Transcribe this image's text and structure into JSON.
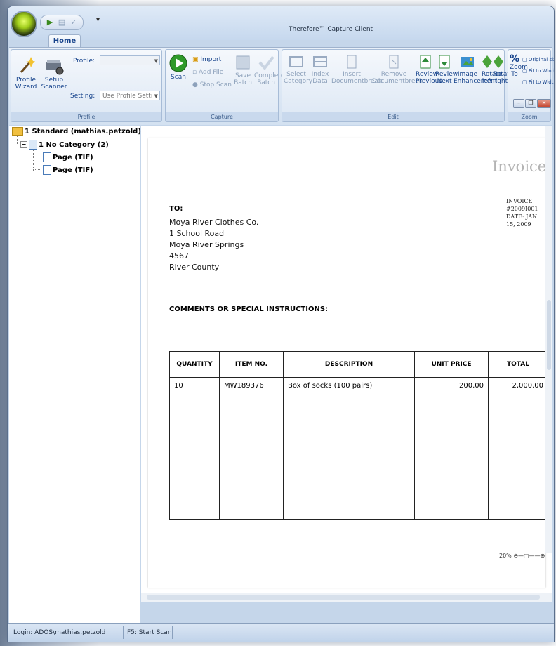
{
  "window": {
    "title": "Therefore™ Capture Client"
  },
  "ribbon": {
    "tab_home": "Home",
    "profile_group": {
      "label": "Profile",
      "profile_wizard": "Profile Wizard",
      "setup_scanner": "Setup Scanner",
      "profile_label": "Profile:",
      "profile_value": "",
      "setting_label": "Setting:",
      "setting_value": "Use Profile Setti"
    },
    "capture_group": {
      "label": "Capture",
      "scan": "Scan",
      "import": "Import",
      "add_file": "Add File",
      "stop_scan": "Stop Scan",
      "save_batch": "Save Batch",
      "complete_batch": "Complete Batch"
    },
    "edit_group": {
      "label": "Edit",
      "select_category": "Select Category",
      "index_data": "Index Data",
      "insert_documentbreak": "Insert Documentbreak",
      "remove_documentbreak": "Remove Documentbreak",
      "review_previous": "Review Previous",
      "review_next": "Review Next",
      "image_enhancement": "Image Enhancement",
      "rotate_left": "Rotate left",
      "rotate_right": "Rotate right"
    },
    "zoom_group": {
      "label": "Zoom",
      "zoom_to": "Zoom To",
      "original_size": "Original size",
      "fit_to_window": "Fit to Window",
      "fit_to_width": "Fit to Width"
    }
  },
  "tree": {
    "root": "1 Standard (mathias.petzold)",
    "category": "1 No Category (2)",
    "pages": [
      "Page (TIF)",
      "Page (TIF)"
    ]
  },
  "document": {
    "title": "Invoice",
    "invoice_no": "INVOICE #2009I001",
    "date": "DATE: JAN 15, 2009",
    "to_label": "TO:",
    "address": [
      "Moya River Clothes Co.",
      "1 School Road",
      "Moya River Springs",
      "4567",
      "River County"
    ],
    "comments_label": "COMMENTS OR SPECIAL INSTRUCTIONS:",
    "table": {
      "headers": [
        "QUANTITY",
        "ITEM NO.",
        "DESCRIPTION",
        "UNIT PRICE",
        "TOTAL"
      ],
      "rows": [
        [
          "10",
          "MW189376",
          "Box of socks (100 pairs)",
          "200.00",
          "2,000.00"
        ]
      ]
    }
  },
  "viewer": {
    "zoom": "20%"
  },
  "status": {
    "login": "Login: ADOS\\mathias.petzold",
    "hint": "F5: Start Scan"
  },
  "colors": {
    "ribbon_text": "#15428b",
    "disabled_text": "#8da1bb",
    "frame": "#c5d6ea"
  }
}
